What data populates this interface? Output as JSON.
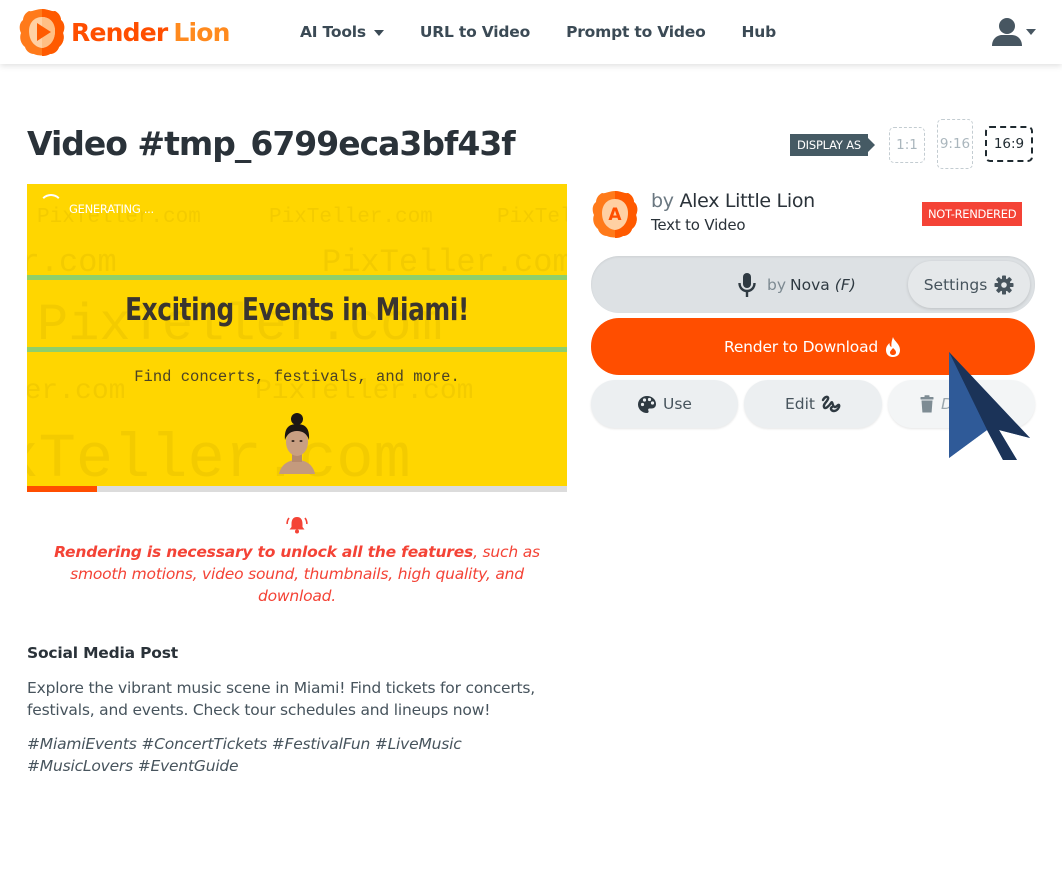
{
  "brand": {
    "name_part1": "Render",
    "name_part2": "Lion",
    "accent_color": "#ff4e00"
  },
  "nav": {
    "items": [
      {
        "label": "AI Tools",
        "has_dropdown": true
      },
      {
        "label": "URL to Video",
        "has_dropdown": false
      },
      {
        "label": "Prompt to Video",
        "has_dropdown": false
      },
      {
        "label": "Hub",
        "has_dropdown": false
      }
    ],
    "user_icon": "user-icon"
  },
  "page": {
    "title": "Video #tmp_6799eca3bf43f"
  },
  "display_as": {
    "label": "DISPLAY AS",
    "options": [
      "1:1",
      "9:16",
      "16:9"
    ],
    "selected": "16:9"
  },
  "video": {
    "status_text": "GENERATING ...",
    "headline": "Exciting Events in Miami!",
    "subline": "Find concerts, festivals, and more.",
    "watermark": "PixTeller.com",
    "background_color": "#ffd600",
    "progress_percent": 13
  },
  "notice": {
    "icon": "bell-icon",
    "bold_text": "Rendering is necessary to unlock all the features",
    "rest_text": ", such as smooth motions, video sound, thumbnails, high quality, and download."
  },
  "social_post": {
    "title": "Social Media Post",
    "body": "Explore the vibrant music scene in Miami! Find tickets for concerts, festivals, and events. Check tour schedules and lineups now!",
    "hashtags": "#MiamiEvents #ConcertTickets #FestivalFun #LiveMusic #MusicLovers #EventGuide"
  },
  "author": {
    "by_label": "by",
    "name": "Alex Little Lion",
    "avatar_letter": "A",
    "type": "Text to Video",
    "status_badge": "NOT-RENDERED",
    "status_color": "#f44336"
  },
  "voice": {
    "by_label": "by",
    "name": "Nova",
    "gender": "(F)",
    "settings_label": "Settings"
  },
  "actions": {
    "render_label": "Render to Download",
    "use_label": "Use",
    "edit_label": "Edit",
    "delete_label": "Delete"
  }
}
